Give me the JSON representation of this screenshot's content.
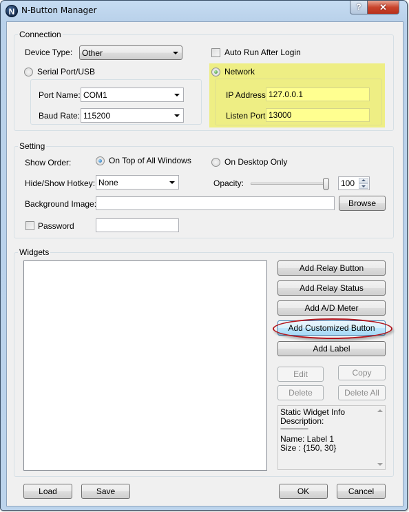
{
  "window": {
    "title": "N-Button Manager",
    "app_icon_letter": "N",
    "help_glyph": "?",
    "close_glyph": "✕"
  },
  "connection": {
    "group_label": "Connection",
    "device_type_label": "Device Type:",
    "device_type_value": "Other",
    "auto_run_label": "Auto Run After Login",
    "auto_run_checked": false,
    "serial_label": "Serial Port/USB",
    "serial_selected": false,
    "port_name_label": "Port Name:",
    "port_name_value": "COM1",
    "baud_rate_label": "Baud Rate:",
    "baud_rate_value": "115200",
    "network_label": "Network",
    "network_selected": true,
    "ip_label": "IP Address:",
    "ip_value": "127.0.0.1",
    "listen_port_label": "Listen Port:",
    "listen_port_value": "13000",
    "highlight_color": "#eeee84"
  },
  "setting": {
    "group_label": "Setting",
    "show_order_label": "Show Order:",
    "on_top_label": "On Top of All Windows",
    "on_top_selected": true,
    "desktop_only_label": "On Desktop Only",
    "desktop_only_selected": false,
    "hotkey_label": "Hide/Show Hotkey:",
    "hotkey_value": "None",
    "opacity_label": "Opacity:",
    "opacity_value": "100",
    "opacity_percent": 100,
    "bg_image_label": "Background Image:",
    "bg_image_value": "",
    "browse_label": "Browse",
    "password_label": "Password",
    "password_checked": false,
    "password_value": ""
  },
  "widgets": {
    "group_label": "Widgets",
    "items": [],
    "buttons": {
      "add_relay_button": "Add Relay Button",
      "add_relay_status": "Add Relay Status",
      "add_ad_meter": "Add A/D Meter",
      "add_customized_button": "Add Customized Button",
      "add_label": "Add Label",
      "edit": "Edit",
      "copy": "Copy",
      "delete": "Delete",
      "delete_all": "Delete All"
    },
    "info_lines": [
      "Static Widget Info",
      "Description:",
      "--------------------",
      "Name: Label 1",
      "Size : {150, 30}"
    ],
    "annotation_color": "#b1161e"
  },
  "footer": {
    "load": "Load",
    "save": "Save",
    "ok": "OK",
    "cancel": "Cancel"
  }
}
